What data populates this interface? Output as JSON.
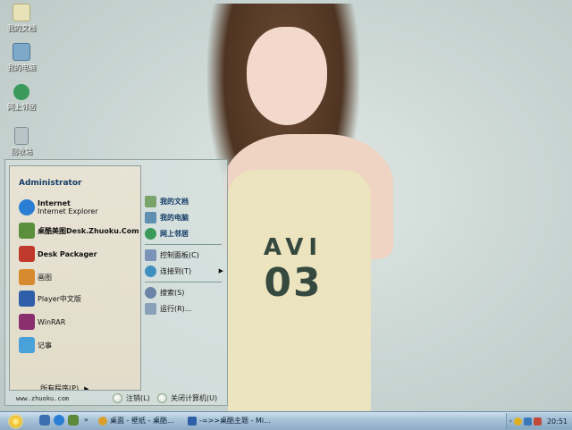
{
  "desktop": {
    "icons": [
      {
        "label": "我的文档",
        "icon": "my-documents-icon",
        "color": "#e8e2b8"
      },
      {
        "label": "我的电脑",
        "icon": "my-computer-icon",
        "color": "#7fa9c9"
      },
      {
        "label": "网上邻居",
        "icon": "network-places-icon",
        "color": "#3a9a5a"
      },
      {
        "label": "回收站",
        "icon": "recycle-bin-icon",
        "color": "#b8c4c8"
      }
    ],
    "wallpaper": {
      "print_line1": "AVI",
      "print_line2": "03"
    }
  },
  "start_menu": {
    "user": "Administrator",
    "programs": [
      {
        "title": "Internet",
        "subtitle": "Internet Explorer",
        "icon": "ie-icon",
        "color": "#2a7fd4"
      },
      {
        "title": "桌酷美图Desk.Zhuoku.Com",
        "subtitle": "",
        "icon": "zhuoku-icon",
        "color": "#5c8f3c"
      },
      {
        "title": "Desk Packager",
        "subtitle": "",
        "icon": "packager-icon",
        "color": "#c0392b"
      },
      {
        "title": "画图",
        "subtitle": "",
        "icon": "paint-icon",
        "color": "#d88a2e"
      },
      {
        "title": "Player中文版",
        "subtitle": "",
        "icon": "player-icon",
        "color": "#2e5fa8"
      },
      {
        "title": "WinRAR",
        "subtitle": "",
        "icon": "winrar-icon",
        "color": "#8a2f6e"
      },
      {
        "title": "记事",
        "subtitle": "",
        "icon": "notepad-icon",
        "color": "#4aa0d8"
      }
    ],
    "all_programs": "所有程序(P)",
    "right_items": [
      {
        "label": "我的文档",
        "icon": "my-documents-icon",
        "color": "#7aa36a",
        "bold": true
      },
      {
        "label": "我的电脑",
        "icon": "my-computer-icon",
        "color": "#5f8fb3",
        "bold": true
      },
      {
        "label": "网上邻居",
        "icon": "network-places-icon",
        "color": "#3a9a5a",
        "bold": true
      },
      {
        "label": "控制面板(C)",
        "icon": "control-panel-icon",
        "color": "#7c93b8",
        "bold": false
      },
      {
        "label": "连接到(T)",
        "icon": "connect-icon",
        "color": "#3f8fbf",
        "bold": false,
        "submenu": true
      },
      {
        "label": "搜索(S)",
        "icon": "search-icon",
        "color": "#6b84a6",
        "bold": false
      },
      {
        "label": "运行(R)...",
        "icon": "run-icon",
        "color": "#8aa0b8",
        "bold": false
      }
    ],
    "footer": {
      "url": "www.zhuoku.com",
      "logoff": "注销(L)",
      "shutdown": "关闭计算机(U)"
    }
  },
  "taskbar": {
    "items": [
      {
        "label": "桌面 - 壁纸 - 桌酷...",
        "icon": "browser-icon",
        "color": "#d9a02b"
      },
      {
        "label": "-=>>桌酷主题 - Mi...",
        "icon": "document-icon",
        "color": "#2f5fa8"
      }
    ],
    "quicklaunch": [
      {
        "icon": "show-desktop-icon",
        "color": "#3c6fb0"
      },
      {
        "icon": "ie-icon",
        "color": "#2a7fd4"
      },
      {
        "icon": "media-icon",
        "color": "#5d8a3a"
      }
    ],
    "tray_icons": [
      {
        "icon": "qq-icon",
        "color": "#e0b020"
      },
      {
        "icon": "network-tray-icon",
        "color": "#3a78b8"
      },
      {
        "icon": "volume-icon",
        "color": "#c24a3a"
      }
    ],
    "clock": "20:51"
  }
}
